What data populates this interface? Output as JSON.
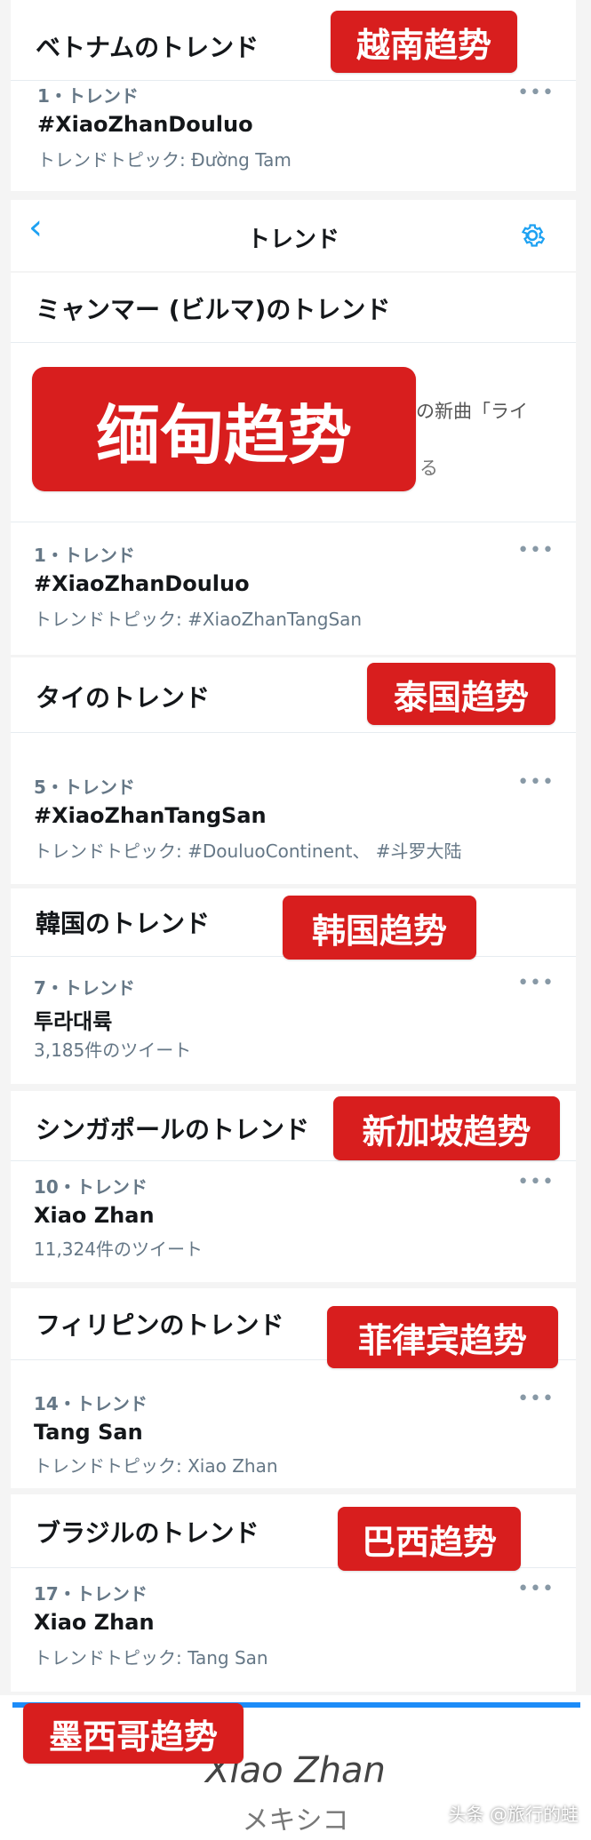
{
  "vietnam": {
    "header": "ベトナムのトレンド",
    "tag": "越南趋势",
    "rank": "1・トレンド",
    "trend": "#XiaoZhanDouluo",
    "meta": "トレンドトピック: Đường Tam"
  },
  "nav": {
    "title": "トレンド"
  },
  "myanmar": {
    "header": "ミャンマー (ビルマ)のトレンド",
    "tag": "缅甸趋势",
    "partial_right_1": "の新曲「ライ",
    "partial_right_2": "る",
    "rank": "1・トレンド",
    "trend": "#XiaoZhanDouluo",
    "meta": "トレンドトピック: #XiaoZhanTangSan"
  },
  "thailand": {
    "header": "タイのトレンド",
    "tag": "泰国趋势",
    "rank": "5・トレンド",
    "trend": "#XiaoZhanTangSan",
    "meta": "トレンドトピック: #DouluoContinent、 #斗罗大陆"
  },
  "korea": {
    "header": "韓国のトレンド",
    "tag": "韩国趋势",
    "rank": "7・トレンド",
    "trend": "투라대륙",
    "meta": "3,185件のツイート"
  },
  "singapore": {
    "header": "シンガポールのトレンド",
    "tag": "新加坡趋势",
    "rank": "10・トレンド",
    "trend": "Xiao Zhan",
    "meta": "11,324件のツイート"
  },
  "philippines": {
    "header": "フィリピンのトレンド",
    "tag": "菲律宾趋势",
    "rank": "14・トレンド",
    "trend": "Tang San",
    "meta": "トレンドトピック: Xiao Zhan"
  },
  "brazil": {
    "header": "ブラジルのトレンド",
    "tag": "巴西趋势",
    "rank": "17・トレンド",
    "trend": "Xiao Zhan",
    "meta": "トレンドトピック: Tang San"
  },
  "mexico": {
    "tag": "墨西哥趋势",
    "title": "Xiao Zhan",
    "subtitle": "メキシコ"
  },
  "more_glyph": "•••",
  "watermark": "头条 @旅行的蛙",
  "colors": {
    "accent": "#1da1f2",
    "tag": "#d81e1e"
  }
}
